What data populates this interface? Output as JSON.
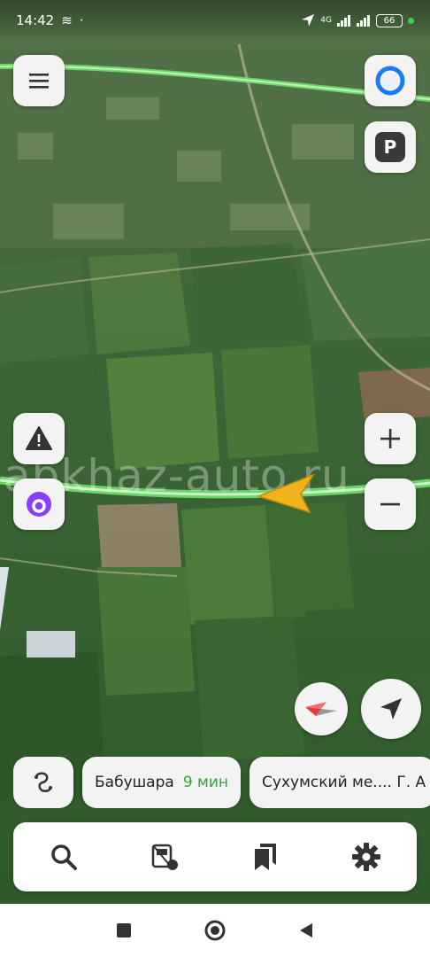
{
  "status_bar": {
    "time": "14:42",
    "network": "4G",
    "battery": "66"
  },
  "map": {
    "watermark": "abkhaz-auto.ru",
    "icons": {
      "menu": "menu-icon",
      "assistant": "alice-assistant-icon",
      "parking": "P",
      "warning": "road-event-warning-icon",
      "alice": "alice-voice-icon",
      "zoom_in": "plus-icon",
      "zoom_out": "minus-icon",
      "compass": "compass-icon",
      "locate": "locate-arrow-icon"
    },
    "colors": {
      "route": "#6fe26a",
      "position_arrow": "#f2b21c",
      "eta": "#2ea632",
      "alice": "#8a3ffc",
      "assistant_ring": "#1d7bf0"
    }
  },
  "destinations": [
    {
      "name": "Бабушара",
      "time": "9 мин"
    },
    {
      "name": "Сухумский ме.... Г. А"
    }
  ],
  "toolbar": {
    "search": "search-icon",
    "transport": "transport-icon",
    "bookmarks": "bookmarks-icon",
    "settings": "settings-gear-icon"
  }
}
